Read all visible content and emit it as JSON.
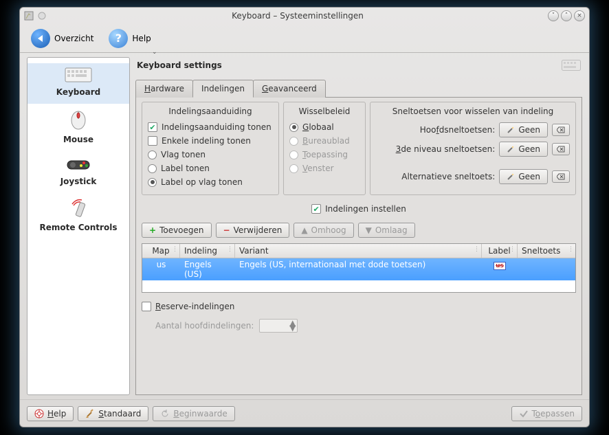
{
  "window": {
    "title": "Keyboard – Systeeminstellingen"
  },
  "toolbar": {
    "overview": "Overzicht",
    "help": "Help"
  },
  "sidebar": {
    "items": [
      {
        "label": "Keyboard"
      },
      {
        "label": "Mouse"
      },
      {
        "label": "Joystick"
      },
      {
        "label": "Remote Controls"
      }
    ]
  },
  "main": {
    "title": "Keyboard settings",
    "tabs": {
      "hardware": "Hardware",
      "indelingen": "Indelingen",
      "geavanceerd": "Geavanceerd"
    },
    "group1": {
      "title": "Indelingsaanduiding",
      "show_indicator": "Indelingsaanduiding tonen",
      "single_layout": "Enkele indeling tonen",
      "show_flag": "Vlag tonen",
      "show_label": "Label tonen",
      "show_label_on_flag": "Label op vlag tonen"
    },
    "group2": {
      "title": "Wisselbeleid",
      "global": "Globaal",
      "desktop": "Bureaublad",
      "application": "Toepassing",
      "window": "Venster"
    },
    "group3": {
      "title": "Sneltoetsen voor wisselen van indeling",
      "main_label": "Hoofdsneltoetsen:",
      "third_label": "3de niveau sneltoetsen:",
      "alt_label": "Alternatieve sneltoets:",
      "none": "Geen"
    },
    "configure_layouts": "Indelingen instellen",
    "buttons": {
      "add": "Toevoegen",
      "remove": "Verwijderen",
      "up": "Omhoog",
      "down": "Omlaag"
    },
    "table": {
      "headers": {
        "map": "Map",
        "indeling": "Indeling",
        "variant": "Variant",
        "label": "Label",
        "sneltoets": "Sneltoets"
      },
      "rows": [
        {
          "map": "us",
          "indeling": "Engels (US)",
          "variant": "Engels (US, internationaal met dode toetsen)",
          "label": "us",
          "sneltoets": ""
        }
      ]
    },
    "reserve": "Reserve-indelingen",
    "main_count": "Aantal hoofdindelingen:"
  },
  "footer": {
    "help": "Help",
    "standaard": "Standaard",
    "beginwaarde": "Beginwaarde",
    "toepassen": "Toepassen"
  }
}
